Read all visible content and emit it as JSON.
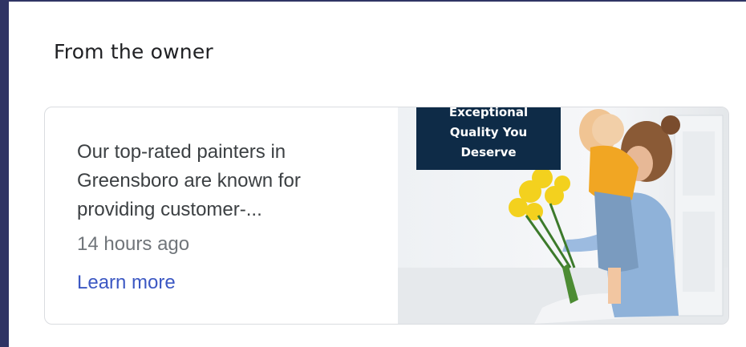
{
  "section": {
    "title": "From the owner"
  },
  "post": {
    "summary": "Our top-rated painters in Greensboro are known for providing customer-...",
    "time": "14 hours ago",
    "learn_more": "Learn more",
    "image": {
      "banner_lines": [
        "Exceptional",
        "Quality You",
        "Deserve"
      ]
    }
  },
  "colors": {
    "border_accent": "#2f3464",
    "link": "#3c58c3",
    "banner_bg": "#0e2b47"
  }
}
